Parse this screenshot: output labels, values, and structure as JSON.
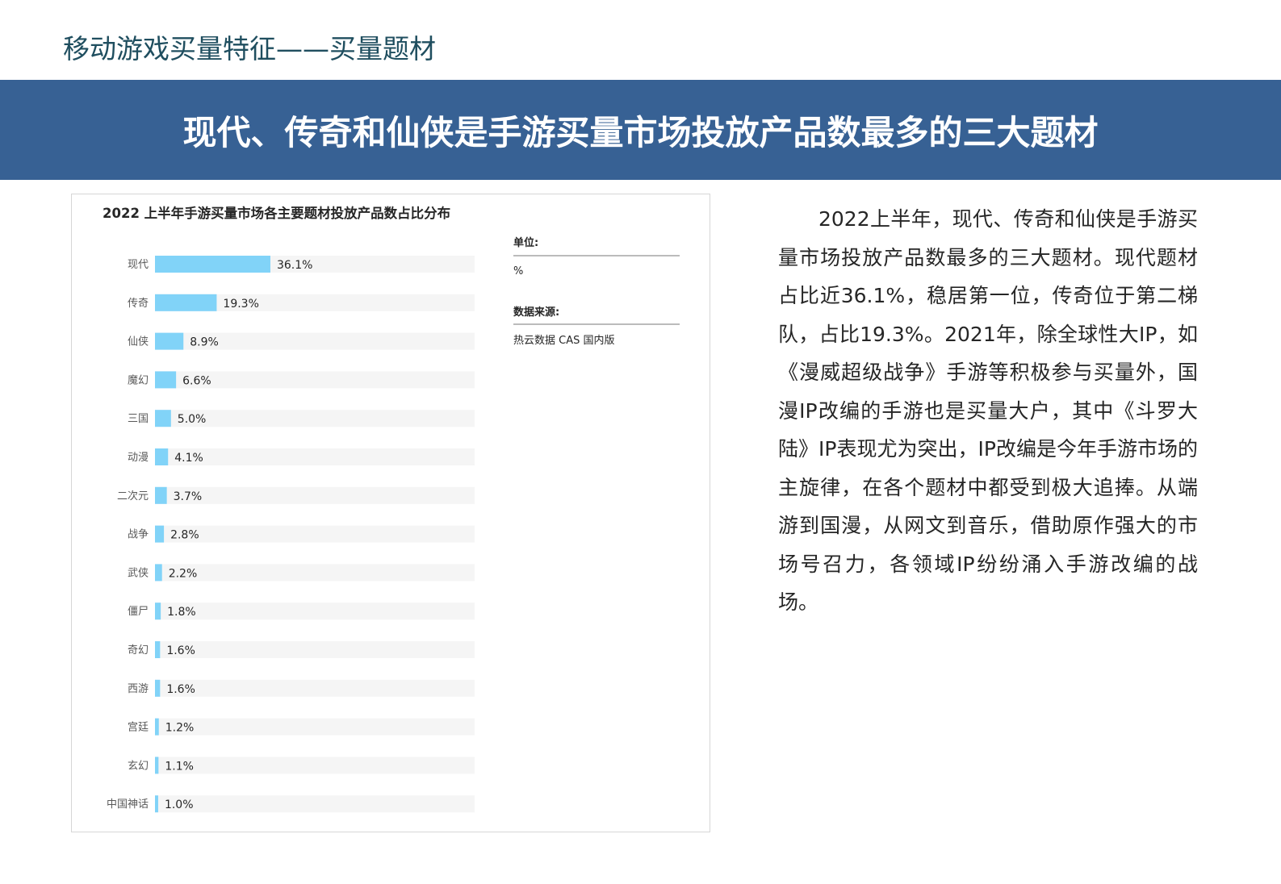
{
  "header": {
    "title": "移动游戏买量特征——买量题材"
  },
  "banner": {
    "text": "现代、传奇和仙侠是手游买量市场投放产品数最多的三大题材"
  },
  "chart_data": {
    "type": "bar",
    "orientation": "horizontal",
    "title": "2022 上半年手游买量市场各主要题材投放产品数占比分布",
    "categories": [
      "现代",
      "传奇",
      "仙侠",
      "魔幻",
      "三国",
      "动漫",
      "二次元",
      "战争",
      "武侠",
      "僵尸",
      "奇幻",
      "西游",
      "宫廷",
      "玄幻",
      "中国神话"
    ],
    "values": [
      36.1,
      19.3,
      8.9,
      6.6,
      5.0,
      4.1,
      3.7,
      2.8,
      2.2,
      1.8,
      1.6,
      1.6,
      1.2,
      1.1,
      1.0
    ],
    "value_labels": [
      "36.1%",
      "19.3%",
      "8.9%",
      "6.6%",
      "5.0%",
      "4.1%",
      "3.7%",
      "2.8%",
      "2.2%",
      "1.8%",
      "1.6%",
      "1.6%",
      "1.2%",
      "1.1%",
      "1.0%"
    ],
    "xlim": [
      0,
      100
    ],
    "bar_color": "#81d3f8",
    "track_color": "#f5f5f5",
    "grid": false,
    "legend": "none",
    "info": {
      "unit_label": "单位:",
      "unit_value": "%",
      "source_label": "数据来源:",
      "source_value": "热云数据 CAS 国内版"
    }
  },
  "body": {
    "paragraph": "2022上半年，现代、传奇和仙侠是手游买量市场投放产品数最多的三大题材。现代题材占比近36.1%，稳居第一位，传奇位于第二梯队，占比19.3%。2021年，除全球性大IP，如《漫威超级战争》手游等积极参与买量外，国漫IP改编的手游也是买量大户，其中《斗罗大陆》IP表现尤为突出，IP改编是今年手游市场的主旋律，在各个题材中都受到极大追捧。从端游到国漫，从网文到音乐，借助原作强大的市场号召力，各领域IP纷纷涌入手游改编的战场。"
  },
  "colors": {
    "banner_bg": "#376194",
    "title_text": "#1f4e5f"
  }
}
